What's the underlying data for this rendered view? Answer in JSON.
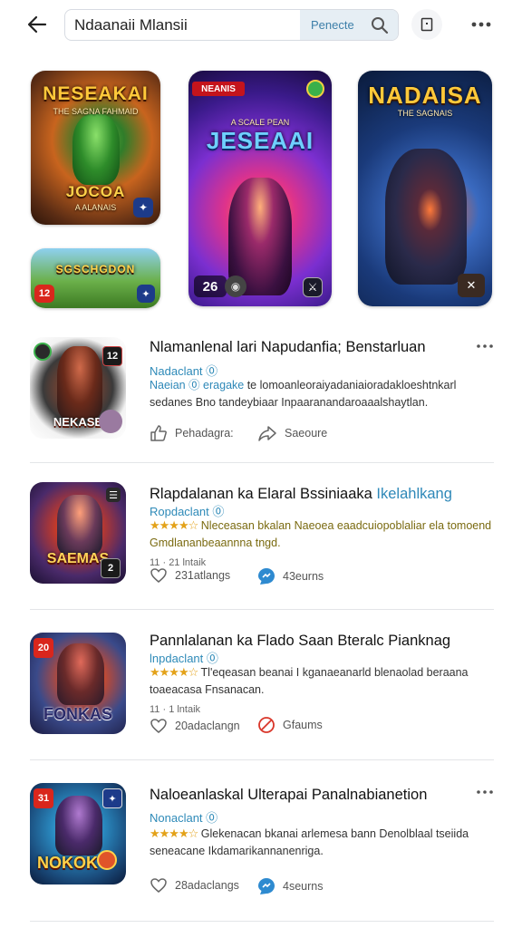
{
  "header": {
    "search_value": "Ndaanaii Mlansii",
    "search_action_label": "Penecte",
    "icons": [
      "back-arrow-icon",
      "search-icon",
      "square-icon",
      "more-dots-icon"
    ]
  },
  "featured": [
    {
      "title": "NESEAKAI",
      "subtitle": "THE SAGNA FAHMAID",
      "label": "JOCOA",
      "caption": "A ALANAIS"
    },
    {
      "title": "SGSCHGDON",
      "badge": "12"
    },
    {
      "top_tag": "NEANIS",
      "title_small": "A SCALE PEAN",
      "title": "JESEAAI",
      "badge": "26"
    },
    {
      "title": "NADAISA",
      "subtitle": "THE SAGNAIS"
    }
  ],
  "items": [
    {
      "title": "Nlamanlenal lari Napudanfia; Benstarluan",
      "title_tag": "",
      "developer": "Nadaclant ⓪",
      "desc_highlight": "Naeian ⓪ eragake",
      "description": " te lomoanleoraiyadaniaioradakloeshtnkarl sedanes Bno tandeybiaar Inpaaranandaroaaalshaytlan.",
      "thumb_label": "NEKASE",
      "thumb_badge": "12",
      "action1": "Pehadagra:",
      "action2": "Saeoure",
      "meta": ""
    },
    {
      "title": "Rlapdalanan ka Elaral Bssiniaaka",
      "title_tag": "Ikelahlkang",
      "developer": "Ropdaclant ⓪",
      "stars": "★★★★☆",
      "description": "Nleceasan bkalan Naeoea eaadcuiopoblaliar ela tomoend Gmdlananbeaannna tngd.",
      "thumb_label": "SAEMAS",
      "thumb_badge": "2",
      "meta": "11 · 21 lntaik",
      "action1": "231atlangs",
      "action2": "43eurns"
    },
    {
      "title": "Pannlalanan ka Flado Saan Bteralc Pianknag",
      "title_tag": "",
      "developer": "lnpdaclant ⓪",
      "stars": "★★★★☆",
      "description": "Tl'eqeasan beanai I kganaeanarld blenaolad beraana toaeacasa Fnsanacan.",
      "thumb_label": "FONKAS",
      "thumb_badge": "20",
      "meta": "11 · 1 lntaik",
      "action1": "20adaclangn",
      "action2": "Gfaums"
    },
    {
      "title": "Naloeanlaskal Ulterapai Panalnabianetion",
      "title_tag": "",
      "developer": "Nonaclant ⓪",
      "stars": "★★★★☆",
      "description": "Glekenacan bkanai arlemesa bann Denolblaal tseiida seneacane Ikdamarikannanenriga.",
      "thumb_label": "NOKOK",
      "thumb_badge": "31",
      "meta": "",
      "action1": "28adaclangs",
      "action2": "4seurns"
    }
  ],
  "colors": {
    "accent": "#2e88b8",
    "star": "#e3a21a",
    "text": "#121212",
    "divider": "#e3e5e8"
  }
}
